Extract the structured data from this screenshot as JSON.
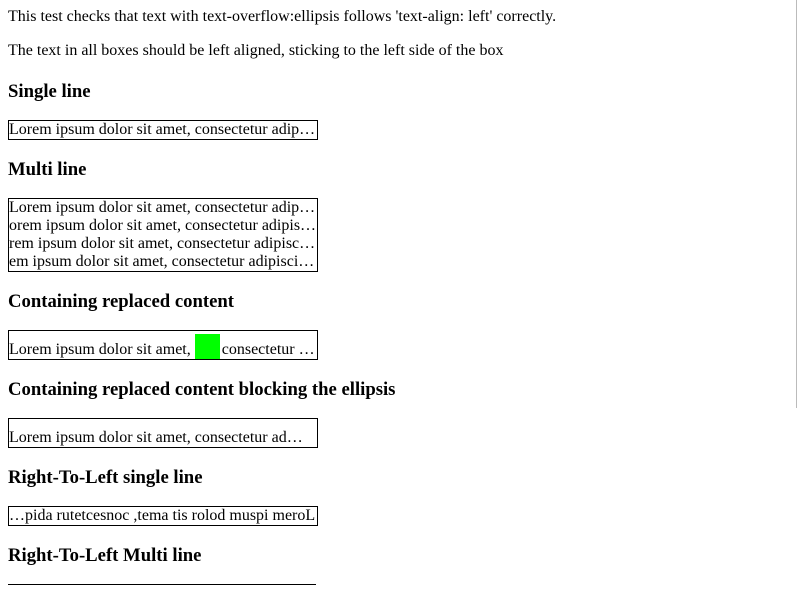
{
  "intro": {
    "line1": "This test checks that text with text-overflow:ellipsis follows 'text-align: left' correctly.",
    "line2": "The text in all boxes should be left aligned, sticking to the left side of the box"
  },
  "sections": {
    "single": {
      "heading": "Single line",
      "text": "Lorem ipsum dolor sit amet, consectetur adip…"
    },
    "multi": {
      "heading": "Multi line",
      "lines": [
        "Lorem ipsum dolor sit amet, consectetur adip…",
        "orem ipsum dolor sit amet, consectetur adipis…",
        "rem ipsum dolor sit amet, consectetur adipisc…",
        "em ipsum dolor sit amet, consectetur adipisci…"
      ]
    },
    "replaced": {
      "heading": "Containing replaced content",
      "before": "Lorem ipsum dolor sit amet,",
      "after": "consectetur …",
      "block_color": "#00ff00"
    },
    "replaced_blocking": {
      "heading": "Containing replaced content blocking the ellipsis",
      "text": "Lorem ipsum dolor sit amet, consectetur ad…"
    },
    "rtl_single": {
      "heading": "Right-To-Left single line",
      "text": "…pida rutetcesnoc ,tema tis rolod muspi meroL"
    },
    "rtl_multi": {
      "heading": "Right-To-Left Multi line"
    }
  }
}
